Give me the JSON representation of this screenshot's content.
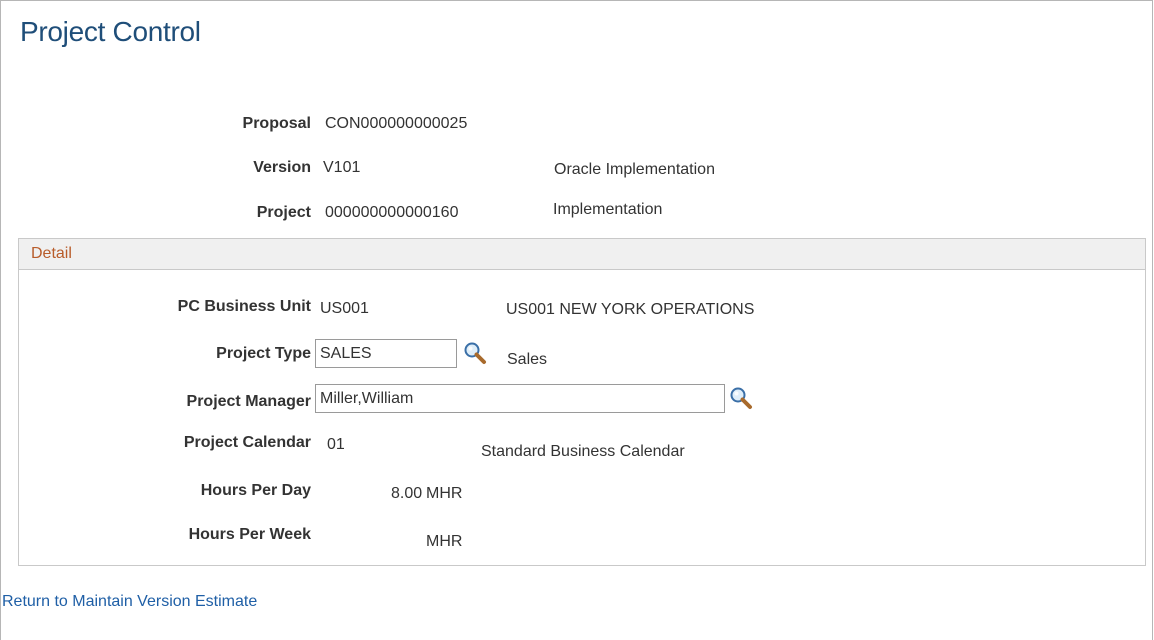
{
  "page": {
    "title": "Project Control"
  },
  "header": {
    "proposal": {
      "label": "Proposal",
      "value": "CON000000000025"
    },
    "version": {
      "label": "Version",
      "value": "V101",
      "description": "Oracle Implementation"
    },
    "project": {
      "label": "Project",
      "value": "000000000000160",
      "description": "Implementation"
    }
  },
  "detail": {
    "title": "Detail",
    "business_unit": {
      "label": "PC Business Unit",
      "value": "US001",
      "description": "US001 NEW YORK OPERATIONS"
    },
    "project_type": {
      "label": "Project Type",
      "value": "SALES",
      "description": "Sales",
      "lookup_icon": "lookup-magnifier-icon"
    },
    "project_manager": {
      "label": "Project Manager",
      "value": "Miller,William",
      "lookup_icon": "lookup-magnifier-icon"
    },
    "project_calendar": {
      "label": "Project Calendar",
      "value": "01",
      "description": "Standard Business Calendar"
    },
    "hours_per_day": {
      "label": "Hours Per Day",
      "value": "8.00",
      "unit": "MHR"
    },
    "hours_per_week": {
      "label": "Hours Per Week",
      "value": "",
      "unit": "MHR"
    }
  },
  "footer": {
    "return_link": "Return to Maintain Version Estimate"
  },
  "colors": {
    "title": "#1f4e79",
    "group_title": "#b85c2a",
    "link": "#1f5fa6",
    "header_bg": "#f0f0f0"
  }
}
